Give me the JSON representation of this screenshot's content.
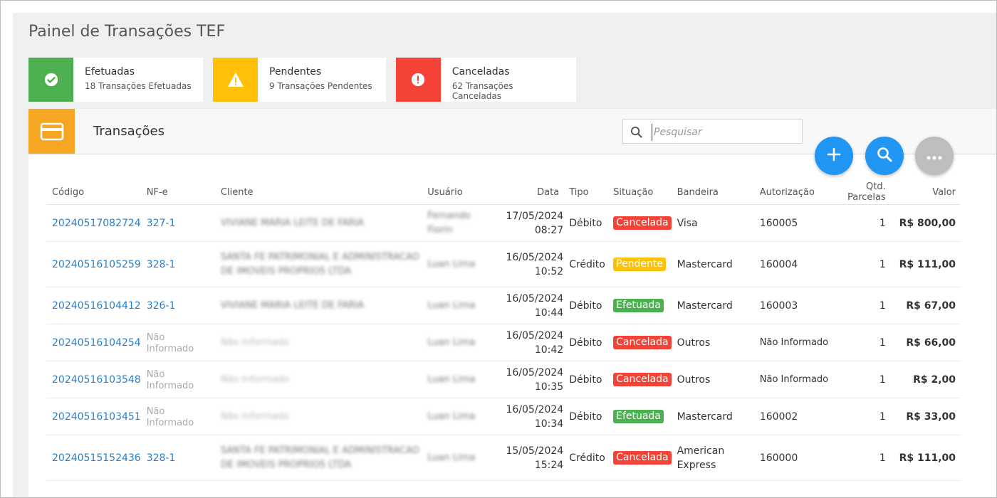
{
  "page": {
    "title": "Painel de Transações TEF"
  },
  "colors": {
    "success": "#4caf50",
    "warning": "#ffc107",
    "danger": "#f44336",
    "accent": "#f5a623",
    "fab_blue": "#2196f3",
    "fab_grey": "#bdbdbd",
    "link": "#2a7fc9"
  },
  "stats": [
    {
      "title": "Efetuadas",
      "subtitle": "18 Transações Efetuadas",
      "icon": "check-circle-icon"
    },
    {
      "title": "Pendentes",
      "subtitle": "9 Transações Pendentes",
      "icon": "warning-icon"
    },
    {
      "title": "Canceladas",
      "subtitle": "62 Transações Canceladas",
      "icon": "alert-circle-icon"
    }
  ],
  "section": {
    "title": "Transações",
    "icon": "credit-card-icon"
  },
  "search": {
    "placeholder": "Pesquisar"
  },
  "actions": {
    "add": "plus-icon",
    "search": "search-icon",
    "more": "more-horizontal-icon"
  },
  "table": {
    "headers": [
      "Código",
      "NF-e",
      "Cliente",
      "Usuário",
      "Data",
      "Tipo",
      "Situação",
      "Bandeira",
      "Autorização",
      "Qtd. Parcelas",
      "Valor"
    ],
    "rows": [
      {
        "codigo": "20240517082724",
        "nfe": "327-1",
        "cliente": "VIVIANE MARIA LEITE DE FARIA",
        "usuario": "Fernando Fiorin",
        "data": "17/05/2024",
        "hora": "08:27",
        "tipo": "Débito",
        "situacao": "Cancelada",
        "bandeira": "Visa",
        "autorizacao": "160005",
        "parcelas": "1",
        "valor": "R$ 800,00"
      },
      {
        "codigo": "20240516105259",
        "nfe": "328-1",
        "cliente": "SANTA FE PATRIMONIAL E ADMINISTRACAO DE IMOVEIS PROPRIOS LTDA",
        "usuario": "Luan Lima",
        "data": "16/05/2024",
        "hora": "10:52",
        "tipo": "Crédito",
        "situacao": "Pendente",
        "bandeira": "Mastercard",
        "autorizacao": "160004",
        "parcelas": "1",
        "valor": "R$ 111,00"
      },
      {
        "codigo": "20240516104412",
        "nfe": "326-1",
        "cliente": "VIVIANE MARIA LEITE DE FARIA",
        "usuario": "Luan Lima",
        "data": "16/05/2024",
        "hora": "10:44",
        "tipo": "Débito",
        "situacao": "Efetuada",
        "bandeira": "Mastercard",
        "autorizacao": "160003",
        "parcelas": "1",
        "valor": "R$ 67,00"
      },
      {
        "codigo": "20240516104254",
        "nfe": "Não Informado",
        "cliente": "Não Informado",
        "usuario": "Luan Lima",
        "data": "16/05/2024",
        "hora": "10:42",
        "tipo": "Débito",
        "situacao": "Cancelada",
        "bandeira": "Outros",
        "autorizacao": "Não Informado",
        "parcelas": "1",
        "valor": "R$ 66,00"
      },
      {
        "codigo": "20240516103548",
        "nfe": "Não Informado",
        "cliente": "Não Informado",
        "usuario": "Luan Lima",
        "data": "16/05/2024",
        "hora": "10:35",
        "tipo": "Débito",
        "situacao": "Cancelada",
        "bandeira": "Outros",
        "autorizacao": "Não Informado",
        "parcelas": "1",
        "valor": "R$ 2,00"
      },
      {
        "codigo": "20240516103451",
        "nfe": "Não Informado",
        "cliente": "Não Informado",
        "usuario": "Luan Lima",
        "data": "16/05/2024",
        "hora": "10:34",
        "tipo": "Débito",
        "situacao": "Efetuada",
        "bandeira": "Mastercard",
        "autorizacao": "160002",
        "parcelas": "1",
        "valor": "R$ 33,00"
      },
      {
        "codigo": "20240515152436",
        "nfe": "328-1",
        "cliente": "SANTA FE PATRIMONIAL E ADMINISTRACAO DE IMOVEIS PROPRIOS LTDA",
        "usuario": "Luan Lima",
        "data": "15/05/2024",
        "hora": "15:24",
        "tipo": "Crédito",
        "situacao": "Cancelada",
        "bandeira": "American Express",
        "autorizacao": "160000",
        "parcelas": "1",
        "valor": "R$ 111,00"
      }
    ]
  }
}
